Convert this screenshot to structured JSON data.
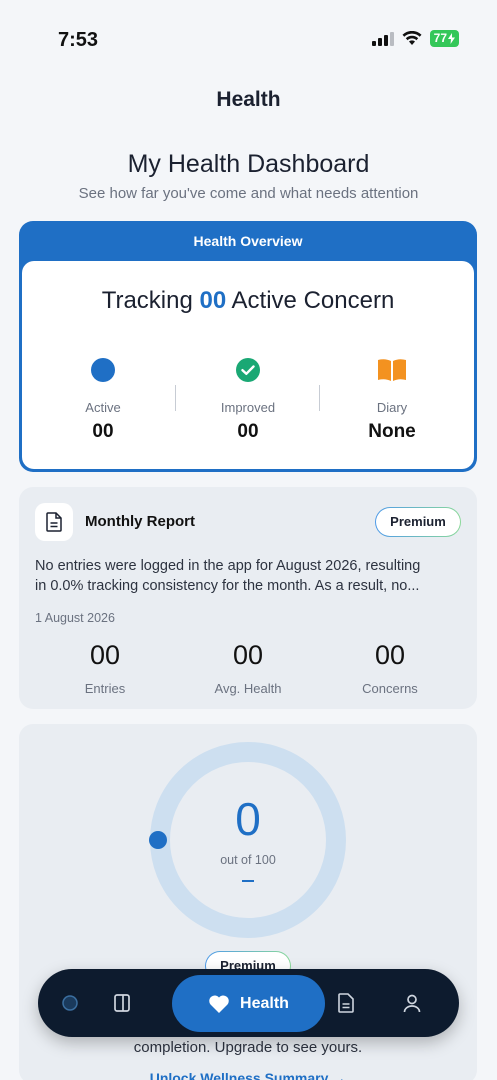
{
  "status": {
    "time": "7:53",
    "battery": "77"
  },
  "header": {
    "title": "Health"
  },
  "dashboard": {
    "title": "My Health Dashboard",
    "subtitle": "See how far you've come and what needs attention"
  },
  "overview": {
    "heading": "Health Overview",
    "tracking_prefix": "Tracking",
    "tracking_count": "00",
    "tracking_suffix": "Active Concern",
    "stats": [
      {
        "label": "Active",
        "value": "00",
        "icon": "blue-dot-icon",
        "color": "#1f6fc5"
      },
      {
        "label": "Improved",
        "value": "00",
        "icon": "check-circle-icon",
        "color": "#1aa874"
      },
      {
        "label": "Diary",
        "value": "None",
        "icon": "book-icon",
        "color": "#f39220"
      }
    ]
  },
  "report": {
    "title": "Monthly Report",
    "badge": "Premium",
    "summary_line1": "No entries were logged in the app for August 2026, resulting",
    "summary_line2": "in 0.0% tracking consistency for the month. As a result, no...",
    "date": "1 August 2026",
    "stats": [
      {
        "value": "00",
        "label": "Entries"
      },
      {
        "value": "00",
        "label": "Avg. Health"
      },
      {
        "value": "00",
        "label": "Concerns"
      }
    ]
  },
  "score": {
    "value": "0",
    "out_of": "out of 100",
    "progress_fraction": 0,
    "badge": "Premium",
    "completion_text": "completion. Upgrade to see yours.",
    "unlock_text": "Unlock Wellness Summary →"
  },
  "tabbar": {
    "active_label": "Health",
    "items": [
      "home-icon",
      "book-outline-icon",
      "heart-icon",
      "document-icon",
      "profile-icon"
    ]
  },
  "colors": {
    "accent": "#1f6fc5",
    "navbar": "#0d1b2e",
    "ring": "#cddff0"
  }
}
